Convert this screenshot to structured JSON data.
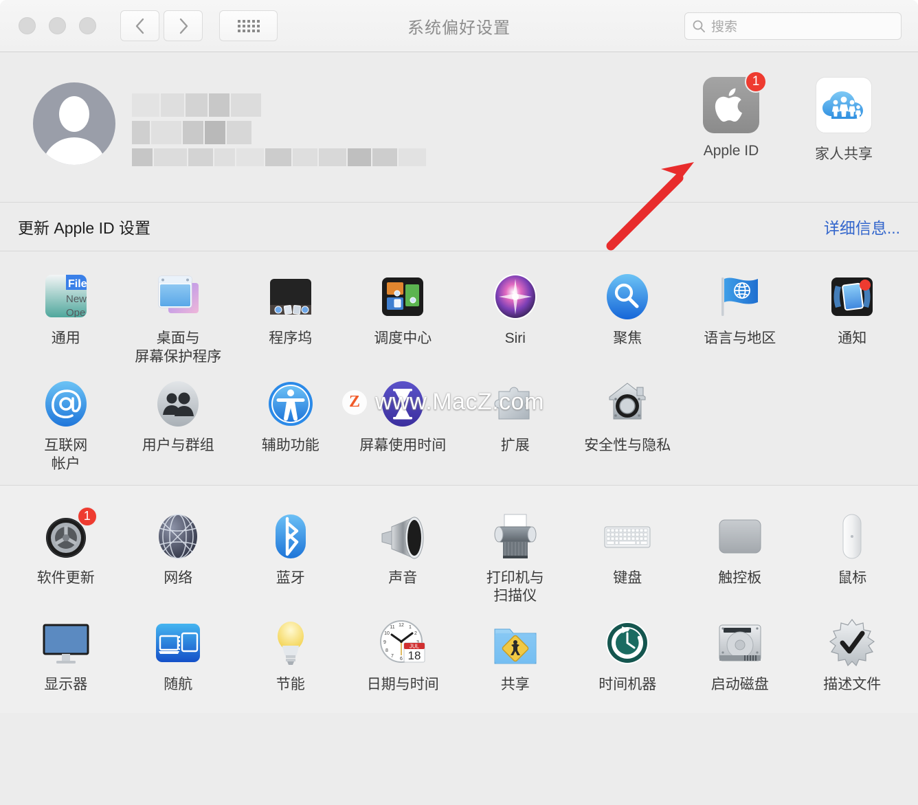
{
  "window": {
    "title": "系统偏好设置",
    "traffic_lights": [
      "close",
      "minimize",
      "zoom"
    ],
    "nav_back": "‹",
    "nav_forward": "›",
    "grid_button": "show-all"
  },
  "search": {
    "placeholder": "搜索"
  },
  "account": {
    "name_redacted": true,
    "apple_id": {
      "label": "Apple ID",
      "badge": "1"
    },
    "family_sharing": {
      "label": "家人共享"
    }
  },
  "update_row": {
    "text": "更新 Apple ID 设置",
    "link": "详细信息..."
  },
  "watermark": {
    "logo": "Z",
    "text": "www.MacZ.com"
  },
  "colors": {
    "badge_red": "#ee3b30",
    "link_blue": "#3366cc",
    "arrow_red": "#e82c2c",
    "window_bg": "#ececec"
  },
  "sections": [
    {
      "name": "personal",
      "rows": [
        [
          {
            "label": "通用",
            "icon": "general-icon"
          },
          {
            "label": "桌面与\n屏幕保护程序",
            "icon": "desktop-screensaver-icon"
          },
          {
            "label": "程序坞",
            "icon": "dock-icon"
          },
          {
            "label": "调度中心",
            "icon": "mission-control-icon"
          },
          {
            "label": "Siri",
            "icon": "siri-icon"
          },
          {
            "label": "聚焦",
            "icon": "spotlight-icon"
          },
          {
            "label": "语言与地区",
            "icon": "language-region-icon"
          },
          {
            "label": "通知",
            "icon": "notifications-icon"
          }
        ],
        [
          {
            "label": "互联网\n帐户",
            "icon": "internet-accounts-icon"
          },
          {
            "label": "用户与群组",
            "icon": "users-groups-icon"
          },
          {
            "label": "辅助功能",
            "icon": "accessibility-icon"
          },
          {
            "label": "屏幕使用时间",
            "icon": "screen-time-icon"
          },
          {
            "label": "扩展",
            "icon": "extensions-icon"
          },
          {
            "label": "安全性与隐私",
            "icon": "security-privacy-icon"
          }
        ]
      ]
    },
    {
      "name": "hardware",
      "rows": [
        [
          {
            "label": "软件更新",
            "icon": "software-update-icon",
            "badge": "1"
          },
          {
            "label": "网络",
            "icon": "network-icon"
          },
          {
            "label": "蓝牙",
            "icon": "bluetooth-icon"
          },
          {
            "label": "声音",
            "icon": "sound-icon"
          },
          {
            "label": "打印机与\n扫描仪",
            "icon": "printers-scanners-icon"
          },
          {
            "label": "键盘",
            "icon": "keyboard-icon"
          },
          {
            "label": "触控板",
            "icon": "trackpad-icon"
          },
          {
            "label": "鼠标",
            "icon": "mouse-icon"
          }
        ],
        [
          {
            "label": "显示器",
            "icon": "displays-icon"
          },
          {
            "label": "随航",
            "icon": "sidecar-icon"
          },
          {
            "label": "节能",
            "icon": "energy-saver-icon"
          },
          {
            "label": "日期与时间",
            "icon": "date-time-icon",
            "calendar_month": "JUL",
            "calendar_day": "18"
          },
          {
            "label": "共享",
            "icon": "sharing-icon"
          },
          {
            "label": "时间机器",
            "icon": "time-machine-icon"
          },
          {
            "label": "启动磁盘",
            "icon": "startup-disk-icon"
          },
          {
            "label": "描述文件",
            "icon": "profiles-icon"
          }
        ]
      ]
    }
  ]
}
